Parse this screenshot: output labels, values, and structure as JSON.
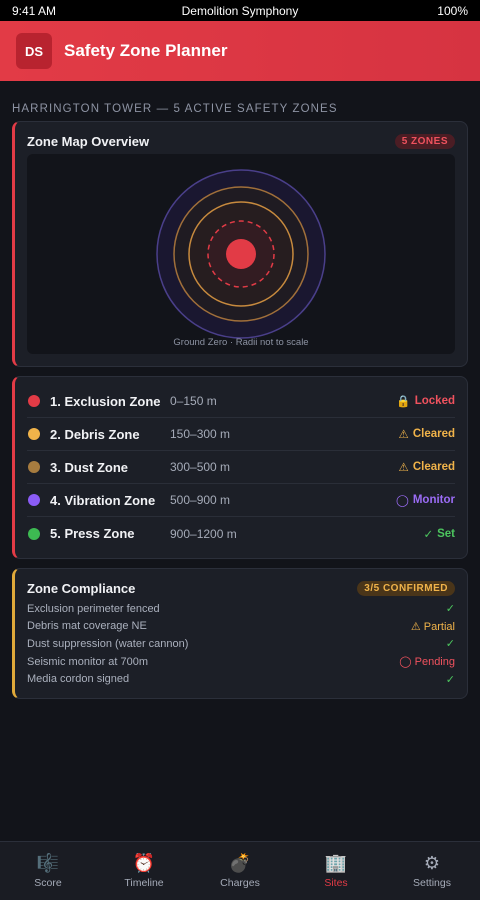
{
  "status_bar": {
    "time": "9:41 AM",
    "carrier": "Demolition Symphony",
    "battery": "100%"
  },
  "app": {
    "logo": "DS",
    "title": "Safety Zone Planner"
  },
  "section_label": "HARRINGTON TOWER — 5 ACTIVE SAFETY ZONES",
  "map_card": {
    "title": "Zone Map Overview",
    "badge": "5 ZONES",
    "caption": "Ground Zero · Radii not to scale",
    "colors": {
      "core": "#e23b46",
      "ring_amber": "#c78a3e",
      "ring_purple": "#4a3f8a"
    }
  },
  "zones": [
    {
      "name": "1. Exclusion Zone",
      "range": "0–150 m",
      "status_icon": "lock-icon",
      "status_glyph": "🔒",
      "status": "Locked",
      "color": "#e23b46",
      "status_color": "#f0525e"
    },
    {
      "name": "2. Debris Zone",
      "range": "150–300 m",
      "status_icon": "warning-icon",
      "status_glyph": "⚠",
      "status": "Cleared",
      "color": "#f0b34a",
      "status_color": "#f0b34a"
    },
    {
      "name": "3. Dust Zone",
      "range": "300–500 m",
      "status_icon": "warning-icon",
      "status_glyph": "⚠",
      "status": "Cleared",
      "color": "#a77c3f",
      "status_color": "#f0b34a"
    },
    {
      "name": "4. Vibration Zone",
      "range": "500–900 m",
      "status_icon": "circle-icon",
      "status_glyph": "◯",
      "status": "Monitor",
      "color": "#8b5cf6",
      "status_color": "#9b6cf6"
    },
    {
      "name": "5. Press Zone",
      "range": "900–1200 m",
      "status_icon": "check-icon",
      "status_glyph": "✓",
      "status": "Set",
      "color": "#3dba52",
      "status_color": "#4cc45e"
    }
  ],
  "compliance": {
    "title": "Zone Compliance",
    "badge": "3/5 CONFIRMED",
    "items": [
      {
        "label": "Exclusion perimeter fenced",
        "status": "✓",
        "status_color": "#4cc45e"
      },
      {
        "label": "Debris mat coverage NE",
        "status": "⚠ Partial",
        "status_color": "#f0b34a"
      },
      {
        "label": "Dust suppression (water cannon)",
        "status": "✓",
        "status_color": "#4cc45e"
      },
      {
        "label": "Seismic monitor at 700m",
        "status": "◯ Pending",
        "status_color": "#f0525e"
      },
      {
        "label": "Media cordon signed",
        "status": "✓",
        "status_color": "#4cc45e"
      }
    ]
  },
  "tabs": [
    {
      "label": "Score",
      "icon": "score-icon",
      "glyph": "🎼",
      "active": false
    },
    {
      "label": "Timeline",
      "icon": "alarm-clock-icon",
      "glyph": "⏰",
      "active": false
    },
    {
      "label": "Charges",
      "icon": "bomb-icon",
      "glyph": "💣",
      "active": false
    },
    {
      "label": "Sites",
      "icon": "building-icon",
      "glyph": "🏢",
      "active": true
    },
    {
      "label": "Settings",
      "icon": "gear-icon",
      "glyph": "⚙",
      "active": false
    }
  ]
}
